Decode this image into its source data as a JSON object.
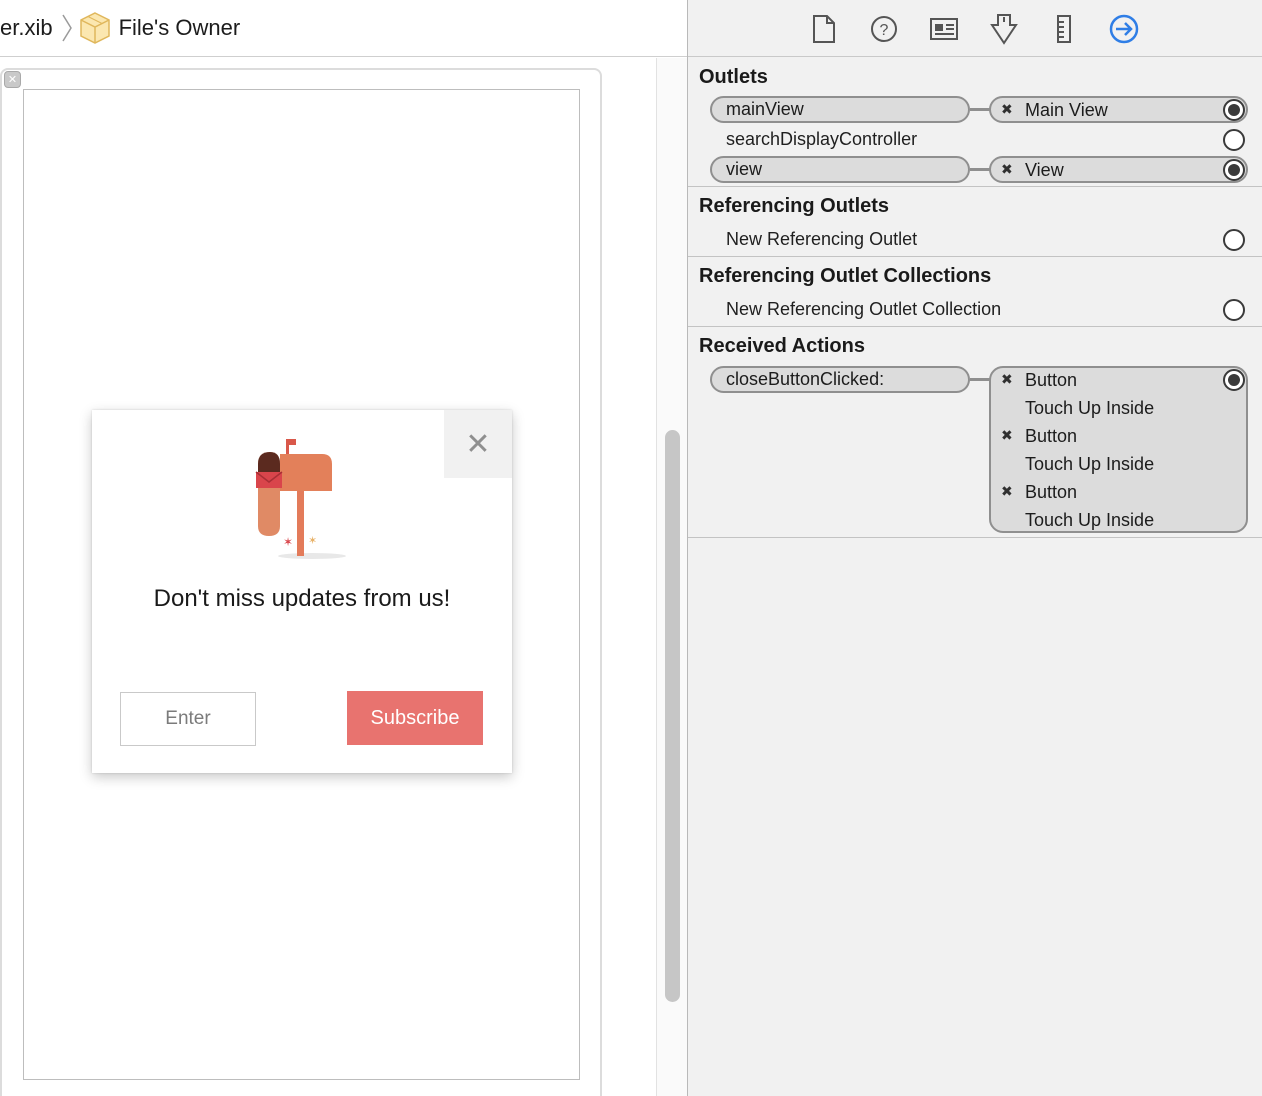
{
  "jumpbar": {
    "file_crumb": "er.xib",
    "owner_crumb": "File's Owner"
  },
  "canvas": {
    "dialog": {
      "message": "Don't miss updates from us!",
      "enter_placeholder": "Enter",
      "subscribe_label": "Subscribe",
      "close_icon": "close-x-icon"
    }
  },
  "inspector": {
    "tabs": [
      "file-inspector-icon",
      "quick-help-icon",
      "identity-inspector-icon",
      "attributes-inspector-icon",
      "size-inspector-icon",
      "connections-inspector-icon"
    ],
    "active_tab_color": "#2f7ee6",
    "outlets": {
      "title": "Outlets",
      "rows": [
        {
          "name": "mainView",
          "target": "Main View",
          "connected": true
        },
        {
          "name": "searchDisplayController",
          "target": "",
          "connected": false
        },
        {
          "name": "view",
          "target": "View",
          "connected": true
        }
      ]
    },
    "referencing_outlets": {
      "title": "Referencing Outlets",
      "row": "New Referencing Outlet"
    },
    "referencing_outlet_collections": {
      "title": "Referencing Outlet Collections",
      "row": "New Referencing Outlet Collection"
    },
    "received_actions": {
      "title": "Received Actions",
      "action": "closeButtonClicked:",
      "targets": [
        {
          "object": "Button",
          "event": "Touch Up Inside"
        },
        {
          "object": "Button",
          "event": "Touch Up Inside"
        },
        {
          "object": "Button",
          "event": "Touch Up Inside"
        }
      ]
    }
  }
}
